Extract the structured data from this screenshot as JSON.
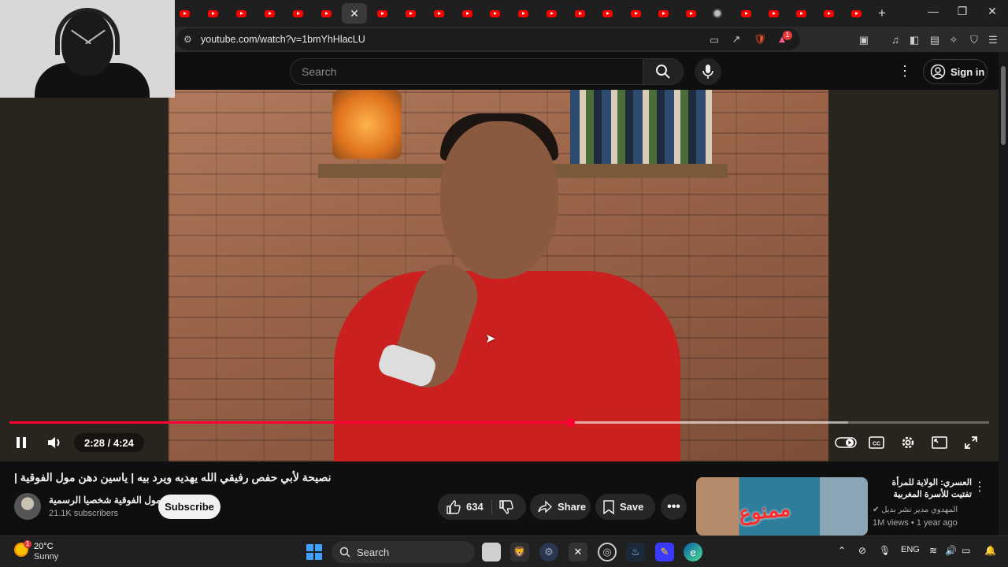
{
  "browser": {
    "tab_count_icons": "youtube-favicon",
    "active_tab_close": "✕",
    "new_tab": "+",
    "url": "youtube.com/watch?v=1bmYhHlacLU",
    "notification_badge": "1",
    "window_controls": {
      "minimize": "—",
      "restore": "❐",
      "close": "✕"
    }
  },
  "youtube": {
    "search_placeholder": "Search",
    "sign_in": "Sign in"
  },
  "player": {
    "time": "2:28 / 4:24",
    "played_fraction": 0.5726,
    "loaded_fraction": 0.8565,
    "colors": {
      "progress": "#ff0033",
      "subscribe_bg": "#f1f1f1",
      "accent_red": "#ff0000"
    }
  },
  "video": {
    "title": "نصيحة لأبي حفص رفيقي الله يهديه ويرد بيه | ياسين دهن مول الفوقية |",
    "channel_name": "مول الفوقية شخصيا الرسمية",
    "subscribers": "21.1K subscribers",
    "subscribe": "Subscribe",
    "likes": "634",
    "share": "Share",
    "save": "Save"
  },
  "recommended": {
    "title": "العسري: الولاية للمرأة تفتيت للأسرة المغربية",
    "channel": "المهدوي مدير نشر بديل",
    "meta": "1M views • 1 year ago",
    "thumb_text": "ممنوع"
  },
  "taskbar": {
    "temp": "20°C",
    "condition": "Sunny",
    "weather_badge": "1",
    "search": "Search",
    "lang": "ENG"
  }
}
